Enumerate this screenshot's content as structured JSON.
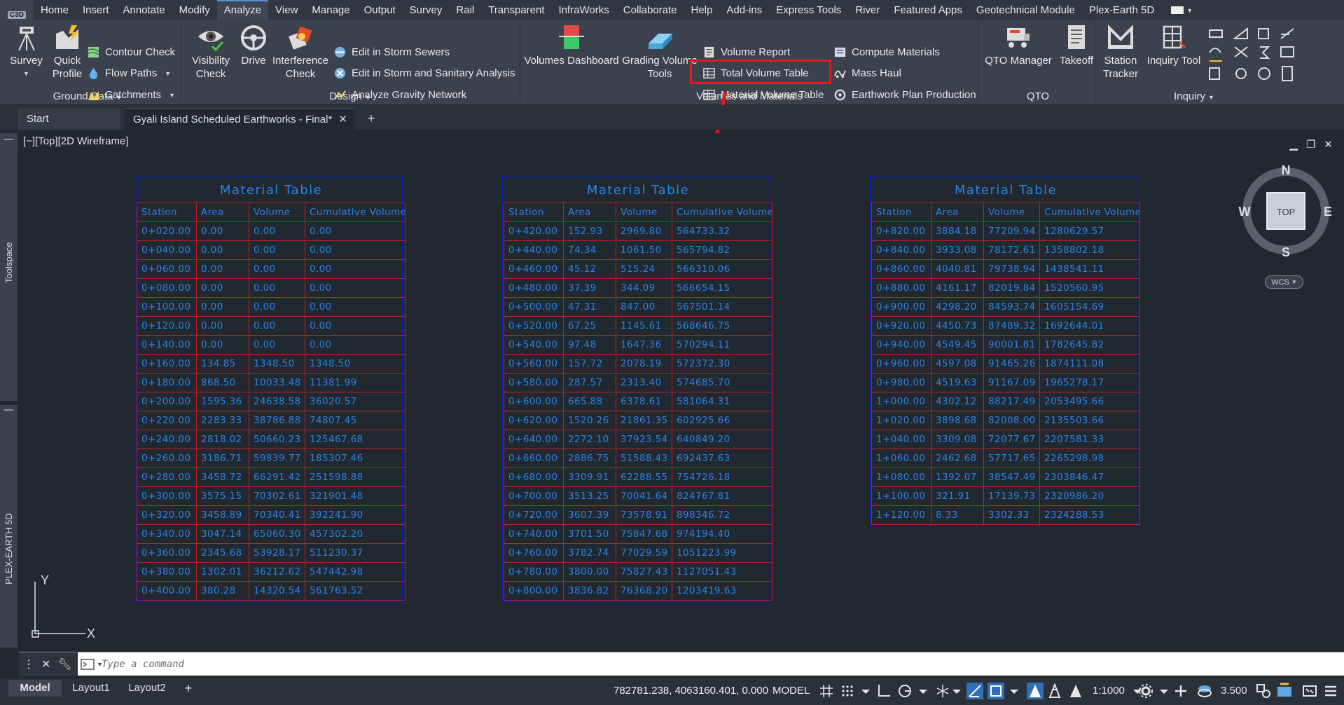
{
  "app": {
    "logo": "C3D"
  },
  "menu": {
    "tabs": [
      "Home",
      "Insert",
      "Annotate",
      "Modify",
      "Analyze",
      "View",
      "Manage",
      "Output",
      "Survey",
      "Rail",
      "Transparent",
      "InfraWorks",
      "Collaborate",
      "Help",
      "Add-ins",
      "Express Tools",
      "River",
      "Featured Apps",
      "Geotechnical Module",
      "Plex-Earth 5D"
    ],
    "active": "Analyze"
  },
  "ribbon": {
    "ground_data": {
      "title": "Ground Data",
      "survey": "Survey",
      "quick_profile": [
        "Quick",
        "Profile"
      ],
      "contour_check": "Contour Check",
      "flow_paths": "Flow Paths",
      "catchments": "Catchments"
    },
    "design": {
      "title": "Design",
      "visibility_check": [
        "Visibility",
        "Check"
      ],
      "drive": "Drive",
      "interference_check": [
        "Interference",
        "Check"
      ],
      "edit_storm_sewers": "Edit in Storm Sewers",
      "edit_storm_sanitary": "Edit in Storm and Sanitary Analysis",
      "analyze_gravity": "Analyze Gravity Network"
    },
    "volumes": {
      "title": "Volumes and Materials",
      "volumes_dashboard": "Volumes Dashboard",
      "grading_volume_tools": [
        "Grading Volume",
        "Tools"
      ],
      "volume_report": "Volume Report",
      "total_volume_table": "Total Volume Table",
      "material_volume_table": "Material Volume Table",
      "compute_materials": "Compute Materials",
      "mass_haul": "Mass Haul",
      "earthwork_plan": "Earthwork Plan Production"
    },
    "qto": {
      "title": "QTO",
      "qto_manager": "QTO Manager",
      "takeoff": "Takeoff"
    },
    "inquiry": {
      "title": "Inquiry",
      "station_tracker": [
        "Station",
        "Tracker"
      ],
      "inquiry_tool": "Inquiry Tool"
    }
  },
  "doc_tabs": {
    "start": "Start",
    "current": "Gyali Island Scheduled Earthworks - Final*"
  },
  "side_panels": {
    "top": "Toolspace",
    "bottom": "PLEX-EARTH 5D"
  },
  "viewport": {
    "label": "[−][Top][2D Wireframe]"
  },
  "compass": {
    "n": "N",
    "s": "S",
    "e": "E",
    "w": "W",
    "top": "TOP",
    "wcs": "WCS"
  },
  "ucs": {
    "x": "X",
    "y": "Y"
  },
  "tables": [
    {
      "title": "Material Table",
      "headers": [
        "Station",
        "Area",
        "Volume",
        "Cumulative Volume"
      ],
      "rows": [
        [
          "0+020.00",
          "0.00",
          "0.00",
          "0.00"
        ],
        [
          "0+040.00",
          "0.00",
          "0.00",
          "0.00"
        ],
        [
          "0+060.00",
          "0.00",
          "0.00",
          "0.00"
        ],
        [
          "0+080.00",
          "0.00",
          "0.00",
          "0.00"
        ],
        [
          "0+100.00",
          "0.00",
          "0.00",
          "0.00"
        ],
        [
          "0+120.00",
          "0.00",
          "0.00",
          "0.00"
        ],
        [
          "0+140.00",
          "0.00",
          "0.00",
          "0.00"
        ],
        [
          "0+160.00",
          "134.85",
          "1348.50",
          "1348.50"
        ],
        [
          "0+180.00",
          "868.50",
          "10033.48",
          "11381.99"
        ],
        [
          "0+200.00",
          "1595.36",
          "24638.58",
          "36020.57"
        ],
        [
          "0+220.00",
          "2283.33",
          "38786.88",
          "74807.45"
        ],
        [
          "0+240.00",
          "2818.02",
          "50660.23",
          "125467.68"
        ],
        [
          "0+260.00",
          "3186.71",
          "59839.77",
          "185307.46"
        ],
        [
          "0+280.00",
          "3458.72",
          "66291.42",
          "251598.88"
        ],
        [
          "0+300.00",
          "3575.15",
          "70302.61",
          "321901.48"
        ],
        [
          "0+320.00",
          "3458.89",
          "70340.41",
          "392241.90"
        ],
        [
          "0+340.00",
          "3047.14",
          "65060.30",
          "457302.20"
        ],
        [
          "0+360.00",
          "2345.68",
          "53928.17",
          "511230.37"
        ],
        [
          "0+380.00",
          "1302.01",
          "36212.62",
          "547442.98"
        ],
        [
          "0+400.00",
          "380.28",
          "14320.54",
          "561763.52"
        ]
      ]
    },
    {
      "title": "Material Table",
      "headers": [
        "Station",
        "Area",
        "Volume",
        "Cumulative Volume"
      ],
      "rows": [
        [
          "0+420.00",
          "152.93",
          "2969.80",
          "564733.32"
        ],
        [
          "0+440.00",
          "74.34",
          "1061.50",
          "565794.82"
        ],
        [
          "0+460.00",
          "45.12",
          "515.24",
          "566310.06"
        ],
        [
          "0+480.00",
          "37.39",
          "344.09",
          "566654.15"
        ],
        [
          "0+500.00",
          "47.31",
          "847.00",
          "567501.14"
        ],
        [
          "0+520.00",
          "67.25",
          "1145.61",
          "568646.75"
        ],
        [
          "0+540.00",
          "97.48",
          "1647.36",
          "570294.11"
        ],
        [
          "0+560.00",
          "157.72",
          "2078.19",
          "572372.30"
        ],
        [
          "0+580.00",
          "287.57",
          "2313.40",
          "574685.70"
        ],
        [
          "0+600.00",
          "665.88",
          "6378.61",
          "581064.31"
        ],
        [
          "0+620.00",
          "1520.26",
          "21861.35",
          "602925.66"
        ],
        [
          "0+640.00",
          "2272.10",
          "37923.54",
          "640849.20"
        ],
        [
          "0+660.00",
          "2886.75",
          "51588.43",
          "692437.63"
        ],
        [
          "0+680.00",
          "3309.91",
          "62288.55",
          "754726.18"
        ],
        [
          "0+700.00",
          "3513.25",
          "70041.64",
          "824767.81"
        ],
        [
          "0+720.00",
          "3607.39",
          "73578.91",
          "898346.72"
        ],
        [
          "0+740.00",
          "3701.50",
          "75847.68",
          "974194.40"
        ],
        [
          "0+760.00",
          "3782.74",
          "77029.59",
          "1051223.99"
        ],
        [
          "0+780.00",
          "3800.00",
          "75827.43",
          "1127051.43"
        ],
        [
          "0+800.00",
          "3836.82",
          "76368.20",
          "1203419.63"
        ]
      ]
    },
    {
      "title": "Material Table",
      "headers": [
        "Station",
        "Area",
        "Volume",
        "Cumulative Volume"
      ],
      "rows": [
        [
          "0+820.00",
          "3884.18",
          "77209.94",
          "1280629.57"
        ],
        [
          "0+840.00",
          "3933.08",
          "78172.61",
          "1358802.18"
        ],
        [
          "0+860.00",
          "4040.81",
          "79738.94",
          "1438541.11"
        ],
        [
          "0+880.00",
          "4161.17",
          "82019.84",
          "1520560.95"
        ],
        [
          "0+900.00",
          "4298.20",
          "84593.74",
          "1605154.69"
        ],
        [
          "0+920.00",
          "4450.73",
          "87489.32",
          "1692644.01"
        ],
        [
          "0+940.00",
          "4549.45",
          "90001.81",
          "1782645.82"
        ],
        [
          "0+960.00",
          "4597.08",
          "91465.26",
          "1874111.08"
        ],
        [
          "0+980.00",
          "4519.63",
          "91167.09",
          "1965278.17"
        ],
        [
          "1+000.00",
          "4302.12",
          "88217.49",
          "2053495.66"
        ],
        [
          "1+020.00",
          "3898.68",
          "82008.00",
          "2135503.66"
        ],
        [
          "1+040.00",
          "3309.08",
          "72077.67",
          "2207581.33"
        ],
        [
          "1+060.00",
          "2462.68",
          "57717.65",
          "2265298.98"
        ],
        [
          "1+080.00",
          "1392.07",
          "38547.49",
          "2303846.47"
        ],
        [
          "1+100.00",
          "321.91",
          "17139.73",
          "2320986.20"
        ],
        [
          "1+120.00",
          "8.33",
          "3302.33",
          "2324288.53"
        ]
      ]
    }
  ],
  "command": {
    "placeholder": "Type a command"
  },
  "layout_tabs": [
    "Model",
    "Layout1",
    "Layout2"
  ],
  "status": {
    "coords": "782781.238, 4063160.401, 0.000",
    "model": "MODEL",
    "scale": "1:1000",
    "anno": "3.500"
  },
  "colors": {
    "table_text": "#2b82e3",
    "table_grid": "#c51d24",
    "table_border": "#0c1aa6",
    "highlight": "#e3191b"
  }
}
